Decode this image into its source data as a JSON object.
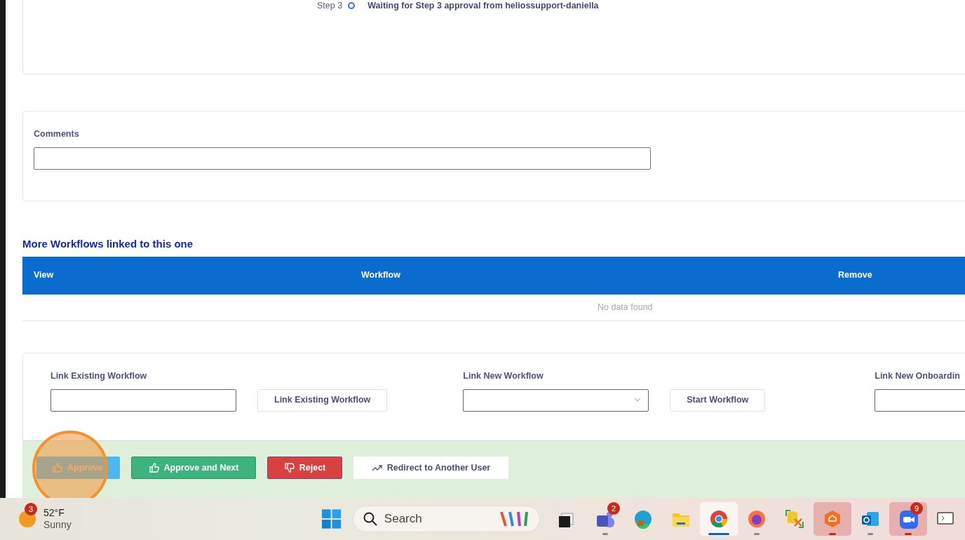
{
  "approval_steps": [
    {
      "step": "Step 3",
      "status": "Waiting for Step 3 approval from heliossupport-daniella",
      "done": false
    }
  ],
  "comments": {
    "label": "Comments"
  },
  "linked_workflows": {
    "title": "More Workflows linked to this one",
    "columns": [
      "View",
      "Workflow",
      "Remove"
    ],
    "empty_text": "No data found"
  },
  "link_panel": [
    {
      "kind": "input",
      "label": "Link Existing Workflow",
      "button": "Link Existing Workflow"
    },
    {
      "kind": "select",
      "label": "Link New Workflow",
      "button": "Start Workflow"
    },
    {
      "kind": "input",
      "label": "Link New Onboardin"
    }
  ],
  "actions": [
    {
      "kind": "approve",
      "label": "Approve"
    },
    {
      "kind": "approve_next",
      "label": "Approve and Next"
    },
    {
      "kind": "reject",
      "label": "Reject"
    },
    {
      "kind": "redirect",
      "label": "Redirect to Another User"
    }
  ],
  "taskbar": {
    "weather": {
      "badge": "3",
      "temperature": "52°F",
      "condition": "Sunny"
    },
    "search": {
      "placeholder": "Search"
    },
    "apps": [
      {
        "kind": "task-view",
        "selected": false,
        "running": false,
        "attention": false
      },
      {
        "kind": "teams",
        "selected": false,
        "running": true,
        "attention": false,
        "badge": "2"
      },
      {
        "kind": "edge",
        "selected": false,
        "running": false,
        "attention": false
      },
      {
        "kind": "folder",
        "selected": false,
        "running": false,
        "attention": false
      },
      {
        "kind": "chrome",
        "selected": true,
        "running": true,
        "attention": false
      },
      {
        "kind": "firefox",
        "selected": false,
        "running": true,
        "attention": false
      },
      {
        "kind": "tool",
        "selected": false,
        "running": false,
        "attention": false
      },
      {
        "kind": "hexagon",
        "selected": false,
        "running": true,
        "attention": true
      },
      {
        "kind": "outlook",
        "selected": false,
        "running": true,
        "attention": false
      },
      {
        "kind": "zoom",
        "selected": false,
        "running": true,
        "attention": true,
        "badge": "9"
      },
      {
        "kind": "screen",
        "selected": false,
        "running": false,
        "attention": false
      }
    ]
  }
}
